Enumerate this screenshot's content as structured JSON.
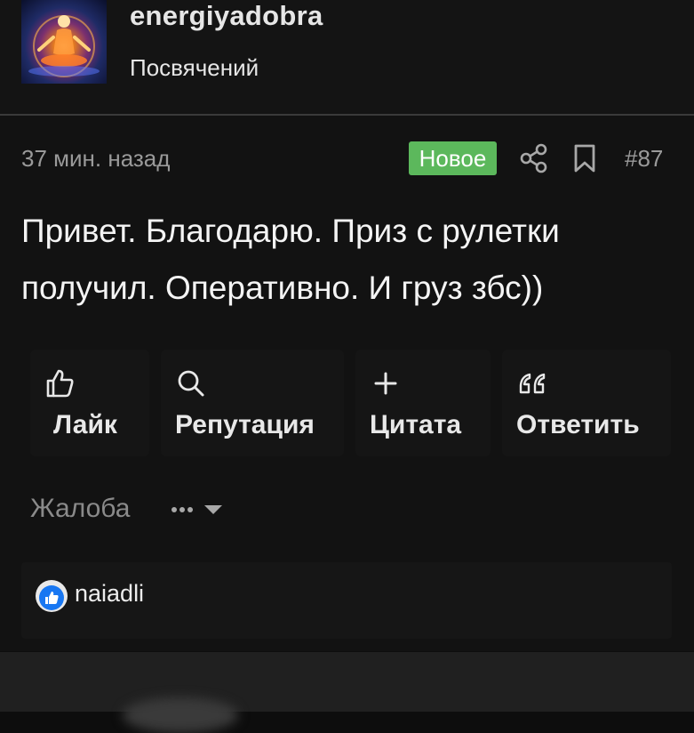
{
  "author": {
    "username": "energiyadobra",
    "title": "Посвячений"
  },
  "post": {
    "time": "37 мин. назад",
    "badge": "Новое",
    "number": "#87",
    "body": "Привет. Благодарю. Приз с рулетки получил. Оперативно. И груз збс))"
  },
  "actions": {
    "like": "Лайк",
    "reputation": "Репутация",
    "quote": "Цитата",
    "reply": "Ответить"
  },
  "footer": {
    "complaint": "Жалоба"
  },
  "reactions": {
    "users": [
      "naiadli"
    ]
  },
  "colors": {
    "background": "#0d0d0d",
    "badge_new": "#5cb85c",
    "like_blue": "#1877f2"
  },
  "icons": [
    "share-icon",
    "bookmark-icon",
    "thumbs-up-icon",
    "search-icon",
    "plus-icon",
    "quote-icon",
    "more-dots-icon",
    "caret-down-icon"
  ]
}
